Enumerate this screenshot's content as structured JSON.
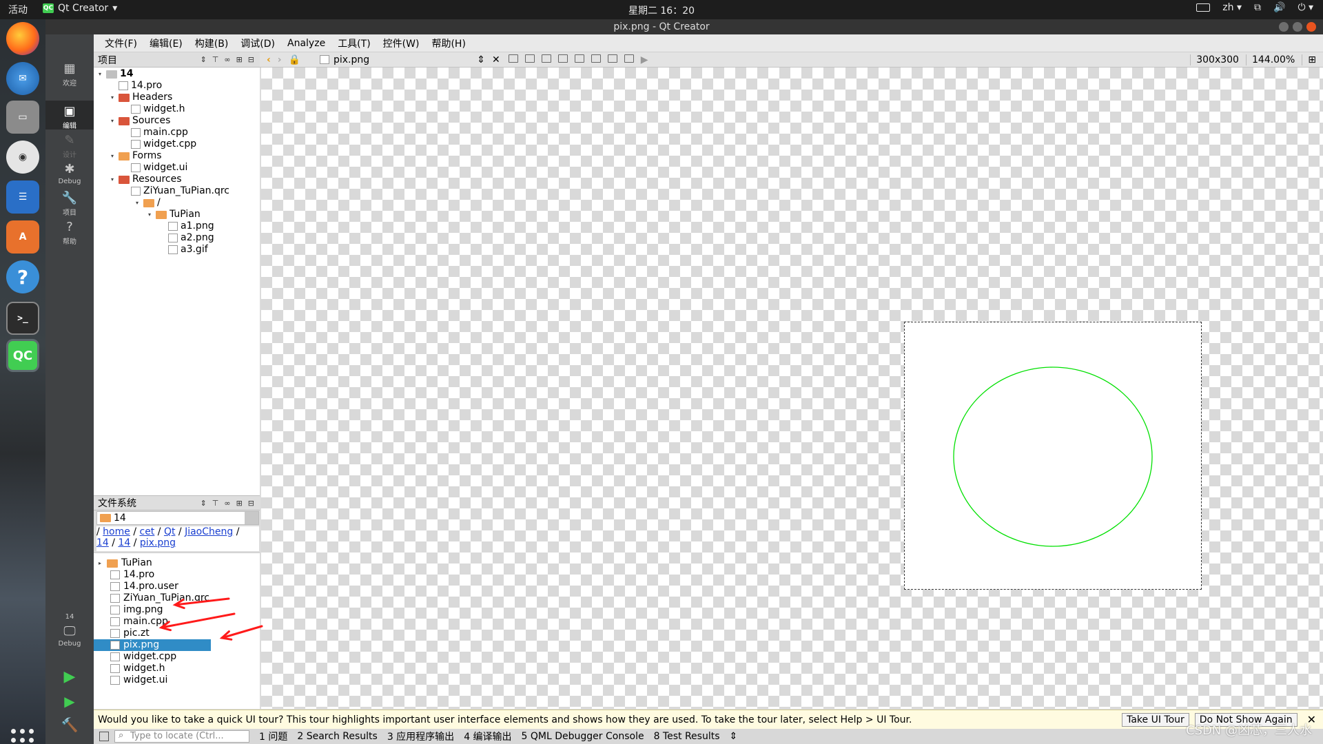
{
  "topbar": {
    "activities": "活动",
    "app_name": "Qt Creator",
    "app_logo": "QC",
    "clock": "星期二 16：20",
    "lang": "zh"
  },
  "window": {
    "title": "pix.png - Qt Creator"
  },
  "dock": {
    "items": [
      {
        "name": "firefox"
      },
      {
        "name": "thunderbird"
      },
      {
        "name": "files"
      },
      {
        "name": "rhythmbox"
      },
      {
        "name": "libreoffice-writer"
      },
      {
        "name": "software"
      },
      {
        "name": "help"
      },
      {
        "name": "terminal"
      },
      {
        "name": "qt-creator"
      }
    ],
    "term_glyph": ">_",
    "qc_glyph": "QC",
    "help_glyph": "?"
  },
  "modes": {
    "welcome": "欢迎",
    "edit": "编辑",
    "design": "设计",
    "debug": "Debug",
    "projects": "项目",
    "help": "帮助",
    "kit_name": "14",
    "kit_mode": "Debug"
  },
  "menu": [
    "文件(F)",
    "编辑(E)",
    "构建(B)",
    "调试(D)",
    "Analyze",
    "工具(T)",
    "控件(W)",
    "帮助(H)"
  ],
  "project_pane": {
    "title": "项目",
    "tree": [
      {
        "label": "14",
        "depth": 0,
        "kind": "project",
        "bold": true
      },
      {
        "label": "14.pro",
        "depth": 1,
        "kind": "file"
      },
      {
        "label": "Headers",
        "depth": 1,
        "kind": "folder"
      },
      {
        "label": "widget.h",
        "depth": 2,
        "kind": "file"
      },
      {
        "label": "Sources",
        "depth": 1,
        "kind": "folder"
      },
      {
        "label": "main.cpp",
        "depth": 2,
        "kind": "file"
      },
      {
        "label": "widget.cpp",
        "depth": 2,
        "kind": "file"
      },
      {
        "label": "Forms",
        "depth": 1,
        "kind": "folder"
      },
      {
        "label": "widget.ui",
        "depth": 2,
        "kind": "file"
      },
      {
        "label": "Resources",
        "depth": 1,
        "kind": "folder"
      },
      {
        "label": "ZiYuan_TuPian.qrc",
        "depth": 2,
        "kind": "file"
      },
      {
        "label": "/",
        "depth": 3,
        "kind": "folder"
      },
      {
        "label": "TuPian",
        "depth": 4,
        "kind": "folder"
      },
      {
        "label": "a1.png",
        "depth": 5,
        "kind": "file"
      },
      {
        "label": "a2.png",
        "depth": 5,
        "kind": "file"
      },
      {
        "label": "a3.gif",
        "depth": 5,
        "kind": "file"
      }
    ]
  },
  "fs_pane": {
    "title": "文件系统",
    "combo": "14",
    "crumb_line1": [
      "home",
      "cet",
      "Qt",
      "JiaoCheng"
    ],
    "crumb_line2": [
      "14",
      "14",
      "pix.png"
    ],
    "sep": "/",
    "items": [
      {
        "label": "TuPian",
        "kind": "folder"
      },
      {
        "label": "14.pro",
        "kind": "file"
      },
      {
        "label": "14.pro.user",
        "kind": "file"
      },
      {
        "label": "ZiYuan_TuPian.qrc",
        "kind": "file"
      },
      {
        "label": "img.png",
        "kind": "file"
      },
      {
        "label": "main.cpp",
        "kind": "file"
      },
      {
        "label": "pic.zt",
        "kind": "file"
      },
      {
        "label": "pix.png",
        "kind": "file",
        "selected": true
      },
      {
        "label": "widget.cpp",
        "kind": "file"
      },
      {
        "label": "widget.h",
        "kind": "file"
      },
      {
        "label": "widget.ui",
        "kind": "file"
      }
    ]
  },
  "editor": {
    "file": "pix.png",
    "size": "300x300",
    "zoom": "144.00%",
    "circle_color": "#00e000"
  },
  "tour": {
    "text": "Would you like to take a quick UI tour? This tour highlights important user interface elements and shows how they are used. To take the tour later, select Help > UI Tour.",
    "take": "Take UI Tour",
    "dismiss": "Do Not Show Again"
  },
  "status": {
    "locator_placeholder": "Type to locate (Ctrl...",
    "panes": [
      "1 问题",
      "2 Search Results",
      "3 应用程序输出",
      "4 编译输出",
      "5 QML Debugger Console",
      "8 Test Results"
    ]
  },
  "watermark": "CSDN @凶芯，三人水",
  "annotation_color": "#ff1a1a"
}
